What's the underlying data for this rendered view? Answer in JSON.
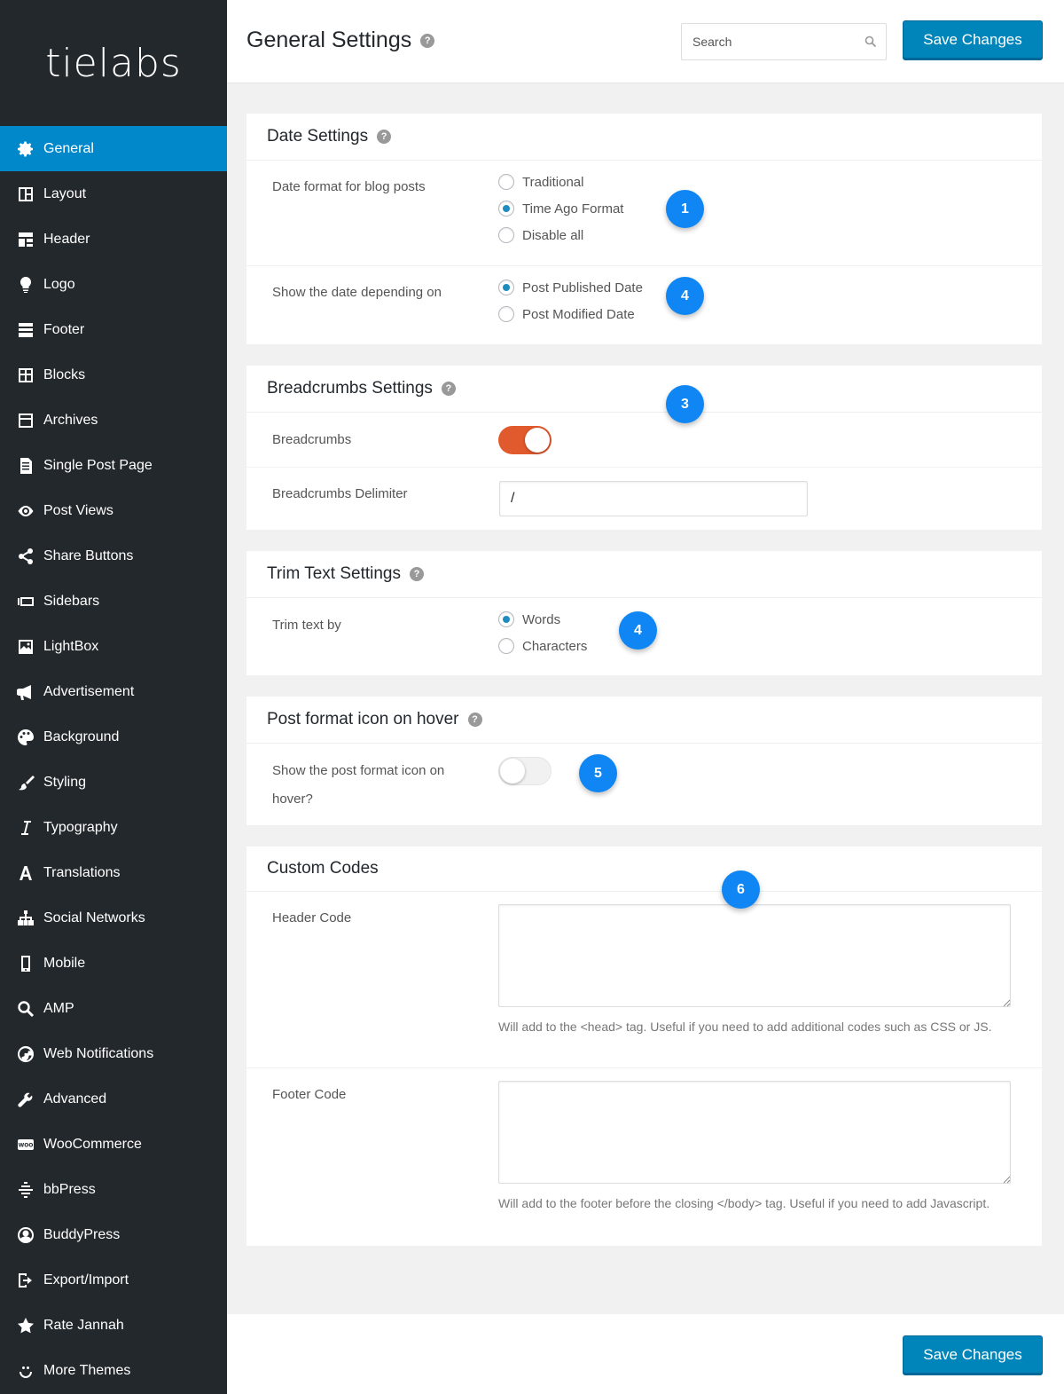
{
  "logo": {
    "text": "tielabs"
  },
  "sidebar": {
    "items": [
      {
        "label": "General",
        "icon": "gear-icon"
      },
      {
        "label": "Layout",
        "icon": "layout-icon"
      },
      {
        "label": "Header",
        "icon": "header-icon"
      },
      {
        "label": "Logo",
        "icon": "lightbulb-icon"
      },
      {
        "label": "Footer",
        "icon": "footer-icon"
      },
      {
        "label": "Blocks",
        "icon": "blocks-icon"
      },
      {
        "label": "Archives",
        "icon": "archives-icon"
      },
      {
        "label": "Single Post Page",
        "icon": "document-icon"
      },
      {
        "label": "Post Views",
        "icon": "eye-icon"
      },
      {
        "label": "Share Buttons",
        "icon": "share-icon"
      },
      {
        "label": "Sidebars",
        "icon": "sidebars-icon"
      },
      {
        "label": "LightBox",
        "icon": "image-icon"
      },
      {
        "label": "Advertisement",
        "icon": "megaphone-icon"
      },
      {
        "label": "Background",
        "icon": "palette-icon"
      },
      {
        "label": "Styling",
        "icon": "brush-icon"
      },
      {
        "label": "Typography",
        "icon": "italic-icon"
      },
      {
        "label": "Translations",
        "icon": "letter-a-icon"
      },
      {
        "label": "Social Networks",
        "icon": "network-icon"
      },
      {
        "label": "Mobile",
        "icon": "mobile-icon"
      },
      {
        "label": "AMP",
        "icon": "search-icon"
      },
      {
        "label": "Web Notifications",
        "icon": "globe-icon"
      },
      {
        "label": "Advanced",
        "icon": "wrench-icon"
      },
      {
        "label": "WooCommerce",
        "icon": "woo-icon"
      },
      {
        "label": "bbPress",
        "icon": "bbpress-icon"
      },
      {
        "label": "BuddyPress",
        "icon": "buddypress-icon"
      },
      {
        "label": "Export/Import",
        "icon": "export-icon"
      },
      {
        "label": "Rate Jannah",
        "icon": "star-icon"
      },
      {
        "label": "More Themes",
        "icon": "smile-icon"
      }
    ],
    "active_index": 0
  },
  "header": {
    "title": "General Settings",
    "search_placeholder": "Search",
    "save_label": "Save Changes"
  },
  "help_glyph": "?",
  "date_settings": {
    "title": "Date Settings",
    "format_label": "Date format for blog posts",
    "format_options": [
      "Traditional",
      "Time Ago Format",
      "Disable all"
    ],
    "format_selected": 1,
    "depend_label": "Show the date depending on",
    "depend_options": [
      "Post Published Date",
      "Post Modified Date"
    ],
    "depend_selected": 0
  },
  "breadcrumbs": {
    "title": "Breadcrumbs Settings",
    "toggle_label": "Breadcrumbs",
    "toggle_on": true,
    "delimiter_label": "Breadcrumbs Delimiter",
    "delimiter_value": "/"
  },
  "trim": {
    "title": "Trim Text Settings",
    "label": "Trim text by",
    "options": [
      "Words",
      "Characters"
    ],
    "selected": 0
  },
  "post_format": {
    "title": "Post format icon on hover",
    "label": "Show the post format icon on hover?",
    "toggle_on": false
  },
  "custom_codes": {
    "title": "Custom Codes",
    "header_label": "Header Code",
    "header_hint": "Will add to the <head> tag. Useful if you need to add additional codes such as CSS or JS.",
    "footer_label": "Footer Code",
    "footer_hint": "Will add to the footer before the closing </body> tag. Useful if you need to add Javascript."
  },
  "badges": [
    "1",
    "4",
    "3",
    "4",
    "5",
    "6"
  ],
  "colors": {
    "sidebar_bg": "#23282d",
    "active_item": "#0088cb",
    "save_button": "#0085ba",
    "toggle_on": "#e15a2d",
    "badge": "#0f86f3"
  }
}
